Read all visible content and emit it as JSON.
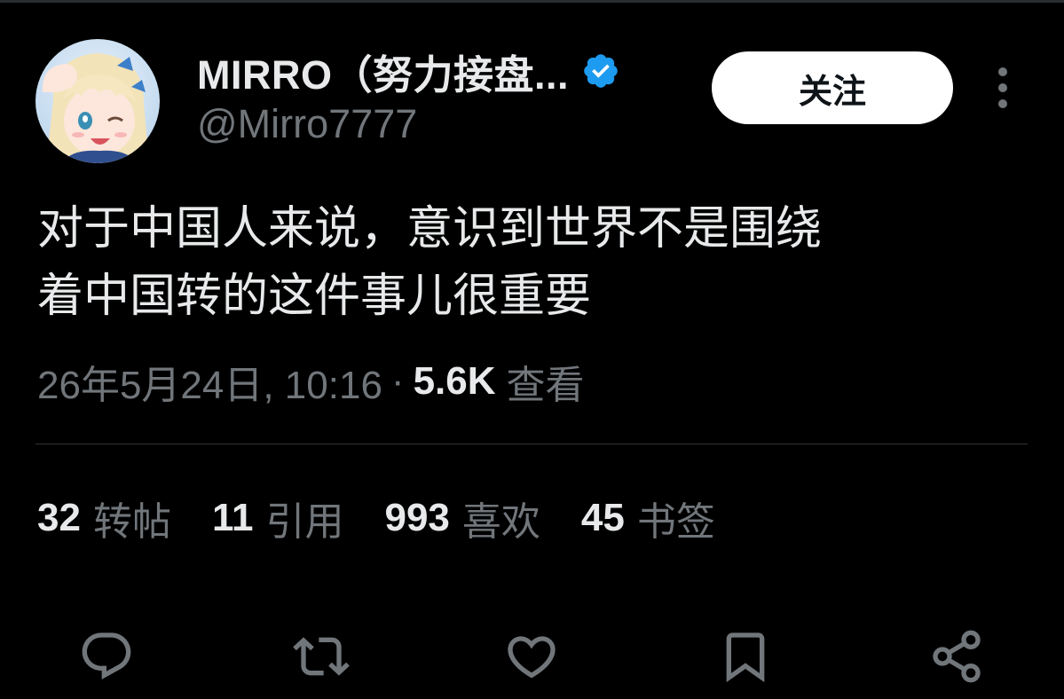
{
  "tweet": {
    "author": {
      "display_name": "MIRRO（努力接盘...",
      "handle": "@Mirro7777",
      "verified_icon": "verified-badge-icon"
    },
    "follow_label": "关注",
    "text_lines": [
      "对于中国人来说，意识到世界不是围绕",
      "着中国转的这件事儿很重要"
    ],
    "timestamp": "26年5月24日, 10:16",
    "separator": "·",
    "views_count": "5.6K",
    "views_label": "查看",
    "stats": [
      {
        "count": "32",
        "label": "转帖"
      },
      {
        "count": "11",
        "label": "引用"
      },
      {
        "count": "993",
        "label": "喜欢"
      },
      {
        "count": "45",
        "label": "书签"
      }
    ],
    "actions": [
      "reply-icon",
      "retweet-icon",
      "like-icon",
      "bookmark-icon",
      "share-icon"
    ]
  },
  "colors": {
    "background": "#000000",
    "primary_text": "#e7e9ea",
    "secondary_text": "#71767b",
    "verified_blue": "#1d9bf0",
    "divider": "#2f3336",
    "follow_button_bg": "#ffffff"
  }
}
